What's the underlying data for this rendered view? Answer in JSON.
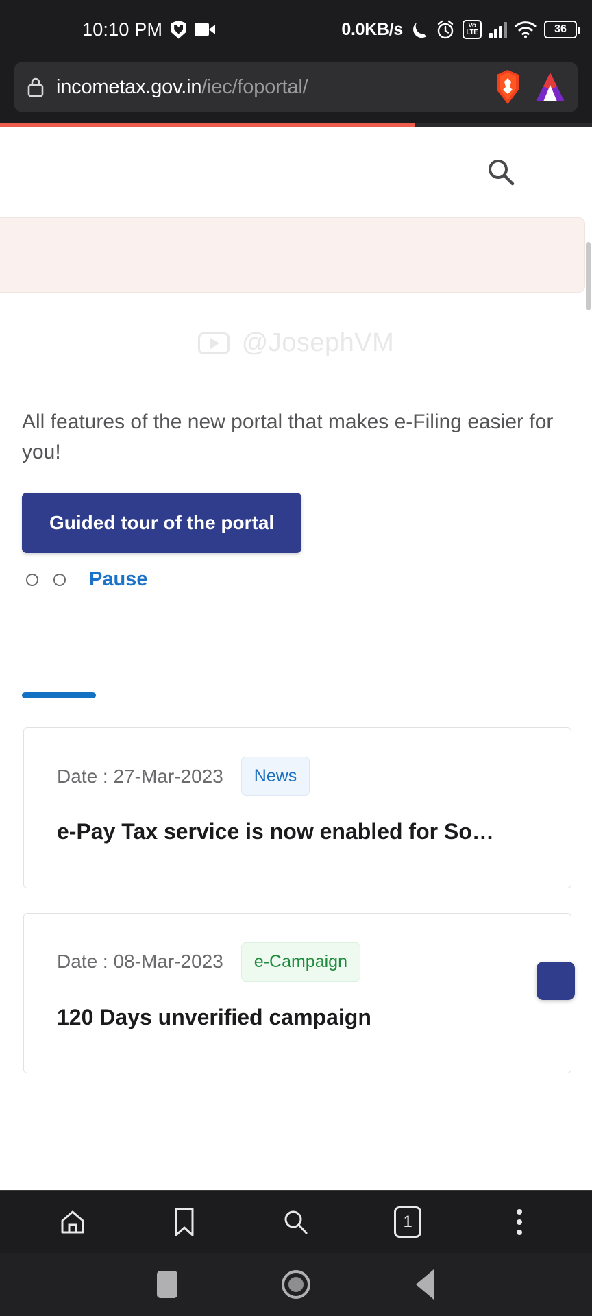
{
  "status_bar": {
    "time": "10:10 PM",
    "network_speed": "0.0KB/s",
    "battery_level": "36",
    "volte_top": "Vo",
    "volte_bottom": "LTE",
    "icons": [
      "brave-shield-icon",
      "screen-recorder-icon",
      "moon-icon",
      "alarm-icon",
      "volte-icon",
      "signal-icon",
      "wifi-icon",
      "battery-icon"
    ]
  },
  "browser": {
    "url_domain": "incometax.gov.in",
    "url_path": "/iec/foportal/",
    "lock_icon": "lock-icon",
    "brave_icon": "brave-lion-icon",
    "bat_icon": "bat-triangle-icon",
    "page_load_progress": 70,
    "progress_color": "#eb5c4d",
    "bottom_nav": {
      "home": "home-icon",
      "bookmarks": "bookmark-icon",
      "search": "search-icon",
      "tab_count": "1",
      "menu": "kebab-menu-icon"
    }
  },
  "page": {
    "search_icon": "search-icon",
    "watermark": {
      "handle": "@JosephVM",
      "icon": "play-button-icon"
    },
    "lede": "All  features of the new portal that makes e-Filing easier for you!",
    "cta_label": "Guided tour of the portal",
    "cta_color": "#2f3d8c",
    "carousel": {
      "dots": [
        "dot-1",
        "dot-2"
      ],
      "pause_label": "Pause",
      "pause_color": "#1a73c8"
    },
    "tab_indicator_color": "#1472c4",
    "cards": [
      {
        "date_label": "Date : 27-Mar-2023",
        "badge": "News",
        "badge_type": "news",
        "badge_color": "#1a6fbf",
        "title": "e-Pay Tax service is now enabled for So…"
      },
      {
        "date_label": "Date : 08-Mar-2023",
        "badge": "e-Campaign",
        "badge_type": "campaign",
        "badge_color": "#1f8b3d",
        "title": "120 Days unverified campaign"
      }
    ],
    "floating_button": "floating-action-button"
  },
  "android_nav": {
    "recents": "recents-square-icon",
    "home": "home-circle-icon",
    "back": "back-triangle-icon"
  }
}
